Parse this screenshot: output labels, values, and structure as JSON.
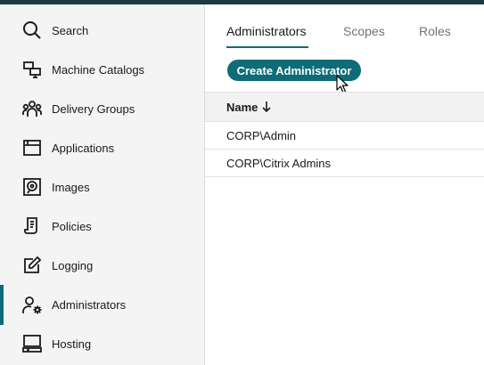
{
  "sidebar": {
    "items": [
      {
        "label": "Search",
        "icon": "search-icon"
      },
      {
        "label": "Machine Catalogs",
        "icon": "machine-catalogs-icon"
      },
      {
        "label": "Delivery Groups",
        "icon": "delivery-groups-icon"
      },
      {
        "label": "Applications",
        "icon": "applications-icon"
      },
      {
        "label": "Images",
        "icon": "images-icon"
      },
      {
        "label": "Policies",
        "icon": "policies-icon"
      },
      {
        "label": "Logging",
        "icon": "logging-icon"
      },
      {
        "label": "Administrators",
        "icon": "administrators-icon",
        "active": true
      },
      {
        "label": "Hosting",
        "icon": "hosting-icon"
      }
    ]
  },
  "main": {
    "tabs": [
      {
        "label": "Administrators",
        "active": true
      },
      {
        "label": "Scopes"
      },
      {
        "label": "Roles"
      }
    ],
    "create_button_label": "Create Administrator",
    "table": {
      "columns": [
        {
          "label": "Name",
          "sort": "descending",
          "sort_icon": "arrow-down-icon"
        }
      ],
      "rows": [
        "CORP\\Admin",
        "CORP\\Citrix Admins"
      ]
    }
  },
  "colors": {
    "accent": "#0e6b78",
    "topbar": "#1d3a40",
    "sidebar_bg": "#f4f4f4",
    "header_bg": "#f2f2f2"
  }
}
